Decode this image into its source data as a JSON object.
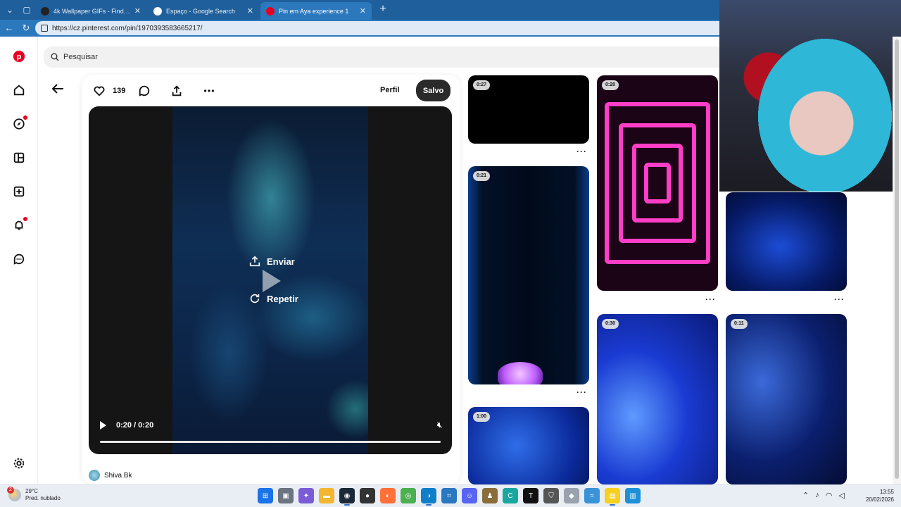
{
  "browser": {
    "tabs": [
      {
        "title": "4k Wallpaper GIFs - Find & Share o",
        "favicon_color": "#222222",
        "active": false
      },
      {
        "title": "Espaço - Google Search",
        "favicon_color": "#ffffff",
        "active": false
      },
      {
        "title": "Pin em Aya experience 1",
        "favicon_color": "#e60023",
        "active": true
      }
    ],
    "url": "https://cz.pinterest.com/pin/1970393583665217/"
  },
  "search": {
    "placeholder": "Pesquisar"
  },
  "pin": {
    "likes": "139",
    "perfil_label": "Perfil",
    "save_label": "Salvo",
    "overlay": {
      "send_label": "Enviar",
      "repeat_label": "Repetir"
    },
    "video_time": "0:20 / 0:20",
    "progress": 1.0,
    "creator": "Shiva Bk"
  },
  "grid": {
    "durations": [
      "0:27",
      "0:21",
      "1:00",
      "0:20",
      "0:30",
      "0:11"
    ],
    "more_label": "···"
  },
  "taskbar": {
    "weather_temp": "29°C",
    "weather_desc": "Pred. nublado",
    "weather_badge": "2",
    "time": "13:55",
    "date": "20/02/2026"
  },
  "colors": {
    "brand": "#e60023",
    "tabbar": "#1f5f9b",
    "save_button": "#2a2a2a"
  }
}
